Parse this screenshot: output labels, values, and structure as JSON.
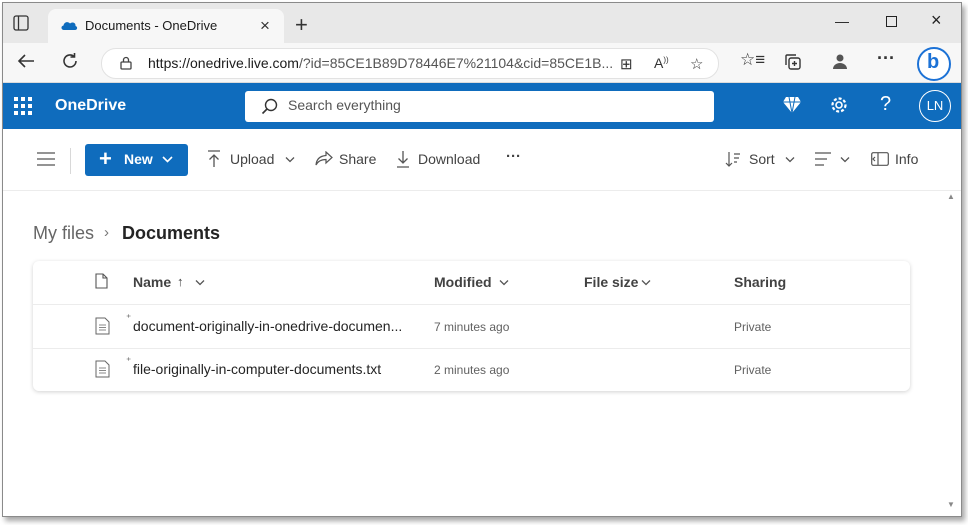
{
  "browser": {
    "tab_title": "Documents - OneDrive",
    "url_host": "https://onedrive.live.com",
    "url_rest": "/?id=85CE1B89D78446E7%21104&cid=85CE1B..."
  },
  "app": {
    "brand": "OneDrive",
    "search_placeholder": "Search everything",
    "avatar_initials": "LN",
    "accent_color": "#0f6cbd"
  },
  "commands": {
    "new_label": "New",
    "upload_label": "Upload",
    "share_label": "Share",
    "download_label": "Download",
    "more_label": "···",
    "sort_label": "Sort",
    "info_label": "Info"
  },
  "breadcrumb": {
    "parent": "My files",
    "current": "Documents"
  },
  "table": {
    "columns": {
      "name": "Name",
      "modified": "Modified",
      "file_size": "File size",
      "sharing": "Sharing"
    },
    "rows": [
      {
        "name": "document-originally-in-onedrive-documen...",
        "modified": "7 minutes ago",
        "file_size": "",
        "sharing": "Private"
      },
      {
        "name": "file-originally-in-computer-documents.txt",
        "modified": "2 minutes ago",
        "file_size": "",
        "sharing": "Private"
      }
    ]
  }
}
